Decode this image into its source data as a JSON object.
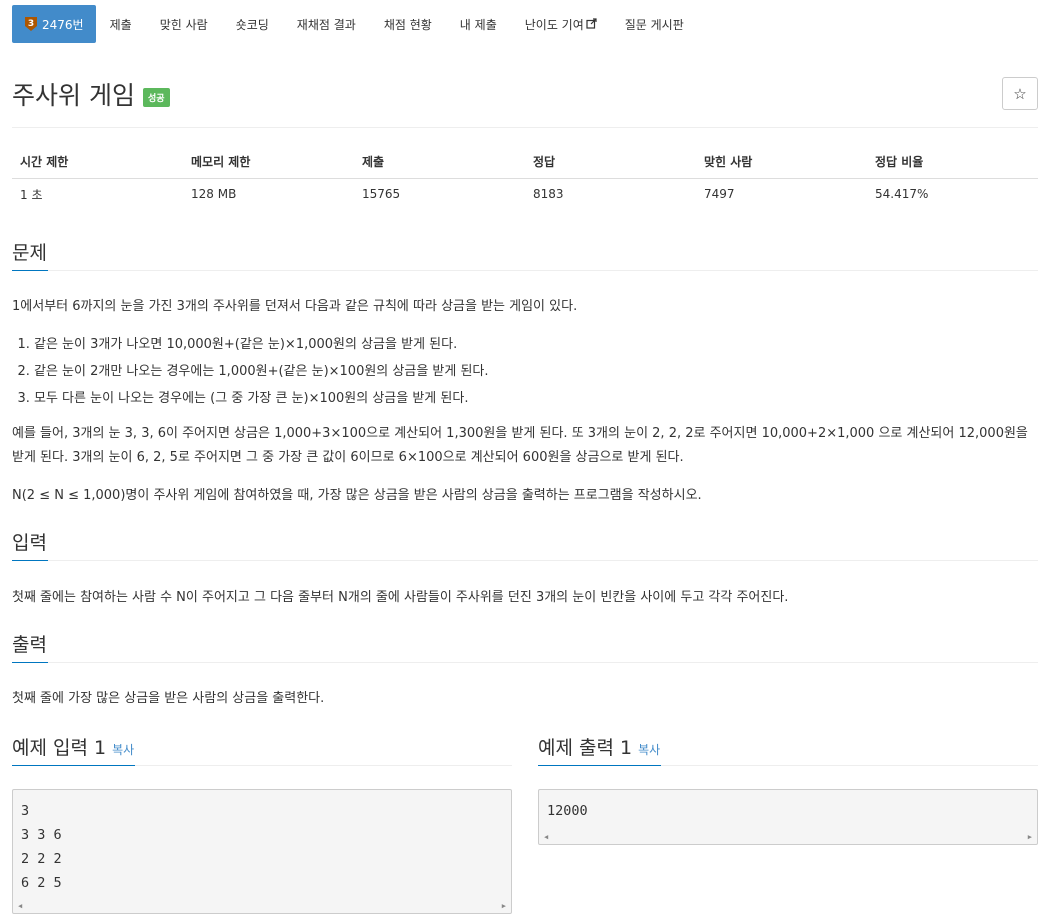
{
  "tabs": [
    {
      "label": "2476번",
      "active": true,
      "tier": "3"
    },
    {
      "label": "제출"
    },
    {
      "label": "맞힌 사람"
    },
    {
      "label": "숏코딩"
    },
    {
      "label": "재채점 결과"
    },
    {
      "label": "채점 현황"
    },
    {
      "label": "내 제출"
    },
    {
      "label": "난이도 기여"
    },
    {
      "label": "질문 게시판"
    }
  ],
  "problem": {
    "title": "주사위 게임",
    "status_badge": "성공",
    "star_icon": "☆"
  },
  "info": {
    "headers": [
      "시간 제한",
      "메모리 제한",
      "제출",
      "정답",
      "맞힌 사람",
      "정답 비율"
    ],
    "values": [
      "1 초",
      "128 MB",
      "15765",
      "8183",
      "7497",
      "54.417%"
    ]
  },
  "sections": {
    "description": {
      "heading": "문제",
      "intro": "1에서부터 6까지의 눈을 가진 3개의 주사위를 던져서 다음과 같은 규칙에 따라 상금을 받는 게임이 있다.",
      "rules": [
        "같은 눈이 3개가 나오면 10,000원+(같은 눈)×1,000원의 상금을 받게 된다.",
        "같은 눈이 2개만 나오는 경우에는 1,000원+(같은 눈)×100원의 상금을 받게 된다.",
        "모두 다른 눈이 나오는 경우에는 (그 중 가장 큰 눈)×100원의 상금을 받게 된다."
      ],
      "example": "예를 들어, 3개의 눈 3, 3, 6이 주어지면 상금은 1,000+3×100으로 계산되어 1,300원을 받게 된다. 또 3개의 눈이 2, 2, 2로 주어지면 10,000+2×1,000 으로 계산되어 12,000원을 받게 된다. 3개의 눈이 6, 2, 5로 주어지면 그 중 가장 큰 값이 6이므로 6×100으로 계산되어 600원을 상금으로 받게 된다.",
      "task": "N(2 ≤ N ≤ 1,000)명이 주사위 게임에 참여하였을 때, 가장 많은 상금을 받은 사람의 상금을 출력하는 프로그램을 작성하시오."
    },
    "input": {
      "heading": "입력",
      "text": "첫째 줄에는 참여하는 사람 수 N이 주어지고 그 다음 줄부터 N개의 줄에 사람들이 주사위를 던진 3개의 눈이 빈칸을 사이에 두고 각각 주어진다."
    },
    "output": {
      "heading": "출력",
      "text": "첫째 줄에 가장 많은 상금을 받은 사람의 상금을 출력한다."
    }
  },
  "samples": {
    "input": {
      "heading": "예제 입력 1",
      "copy_label": "복사",
      "content": "3\n3 3 6\n2 2 2\n6 2 5"
    },
    "output": {
      "heading": "예제 출력 1",
      "copy_label": "복사",
      "content": "12000"
    }
  },
  "colors": {
    "active_tab": "#428bca",
    "success_badge": "#5cb85c",
    "heading_underline": "#0076c0",
    "link": "#428bca"
  }
}
